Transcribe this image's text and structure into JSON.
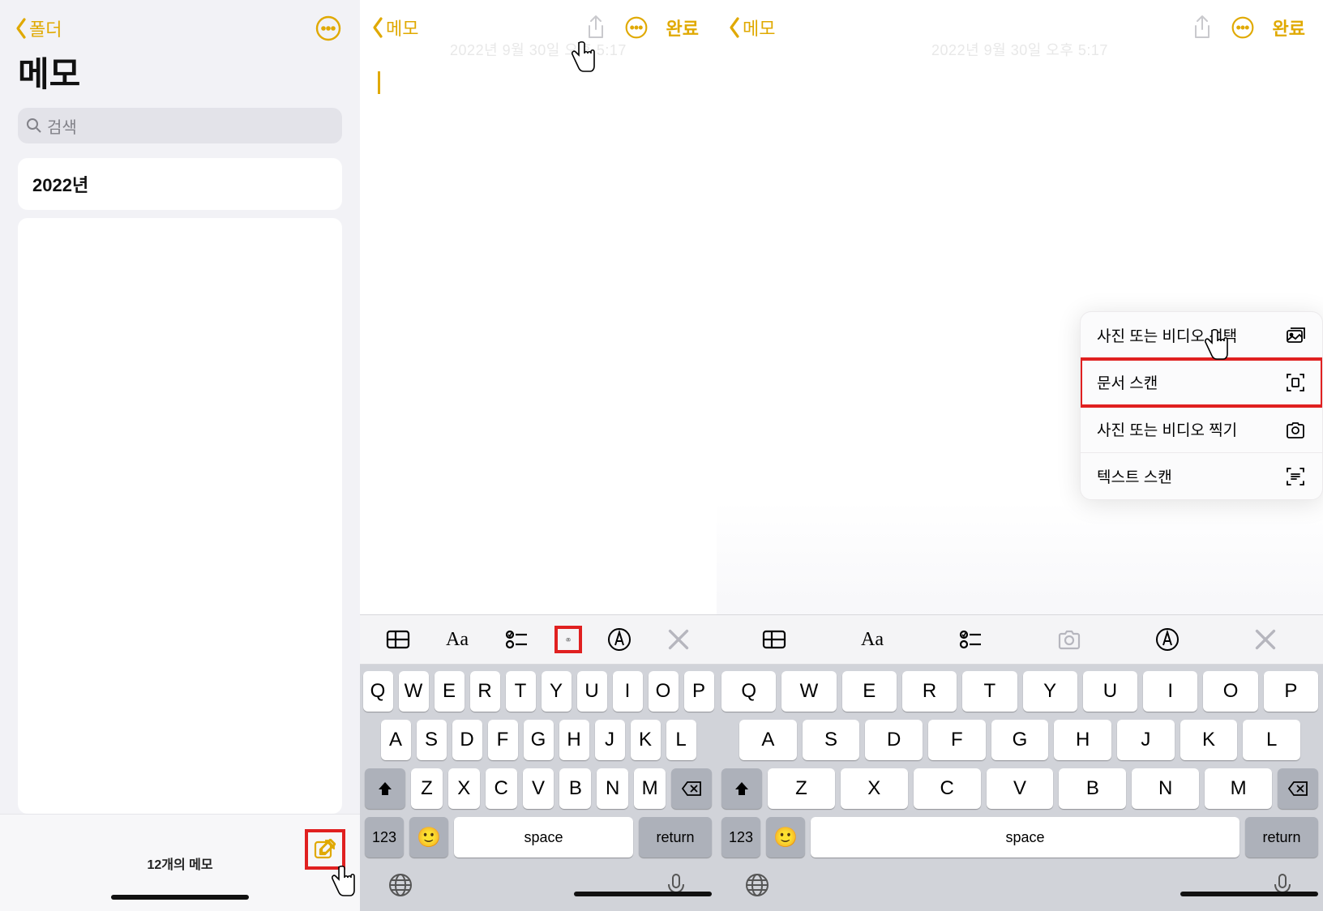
{
  "panel1": {
    "back_label": "폴더",
    "title": "메모",
    "search_placeholder": "검색",
    "note_year": "2022년",
    "count_label": "12개의 메모"
  },
  "panel2": {
    "back_label": "메모",
    "done_label": "완료",
    "date_stamp": "2022년 9월 30일 오후 5:17"
  },
  "panel3": {
    "back_label": "메모",
    "done_label": "완료",
    "date_stamp": "2022년 9월 30일 오후 5:17",
    "menu": {
      "choose": "사진 또는 비디오 선택",
      "scan_doc": "문서 스캔",
      "take": "사진 또는 비디오 찍기",
      "scan_text": "텍스트 스캔"
    }
  },
  "keyboard": {
    "row1": [
      "Q",
      "W",
      "E",
      "R",
      "T",
      "Y",
      "U",
      "I",
      "O",
      "P"
    ],
    "row2": [
      "A",
      "S",
      "D",
      "F",
      "G",
      "H",
      "J",
      "K",
      "L"
    ],
    "row3": [
      "Z",
      "X",
      "C",
      "V",
      "B",
      "N",
      "M"
    ],
    "mode_key": "123",
    "space": "space",
    "return": "return"
  }
}
